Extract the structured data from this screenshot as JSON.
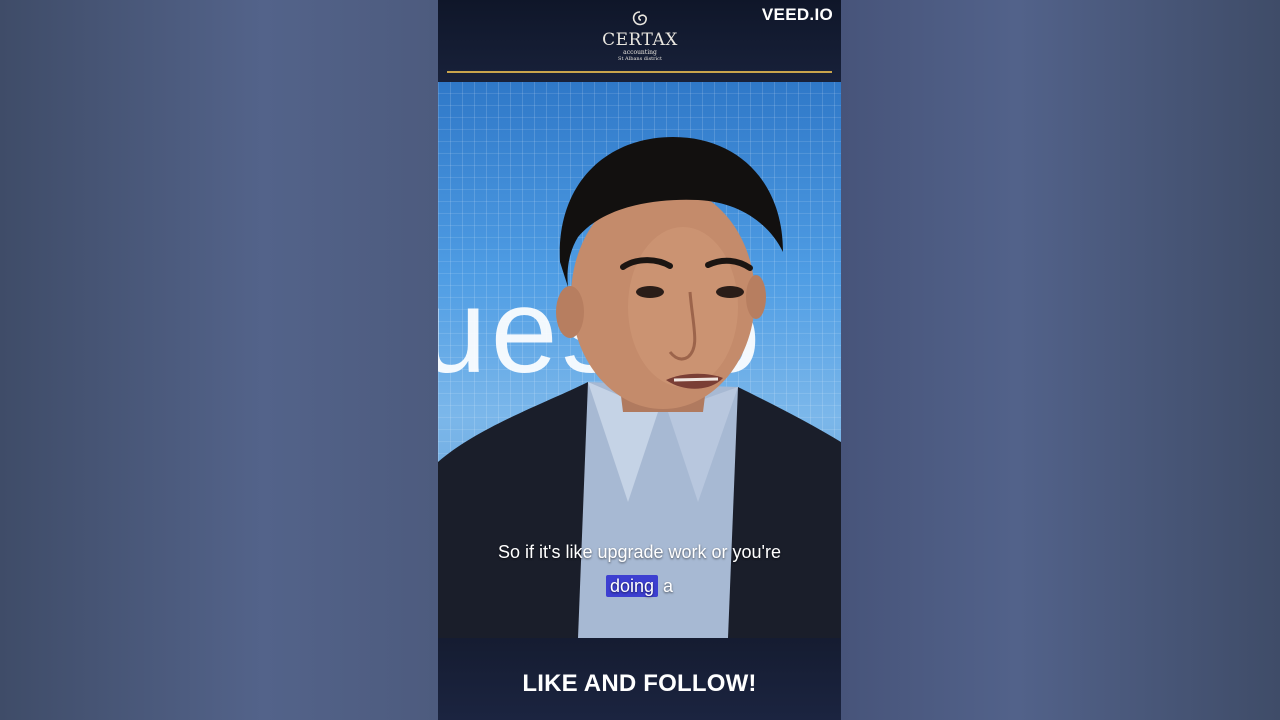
{
  "brand": {
    "name": "CERTAX",
    "subtitle": "accounting",
    "region": "St Albans district",
    "accent_color": "#c9a44c"
  },
  "watermark": {
    "text": "VEED.IO"
  },
  "background": {
    "letters": "ues io"
  },
  "subtitles": {
    "line1": "So if it's like upgrade work or you're",
    "line2_highlight": "doing",
    "line2_rest": " a",
    "highlight_color": "#3d3fd1"
  },
  "call_to_action": {
    "text": "LIKE AND FOLLOW!"
  }
}
